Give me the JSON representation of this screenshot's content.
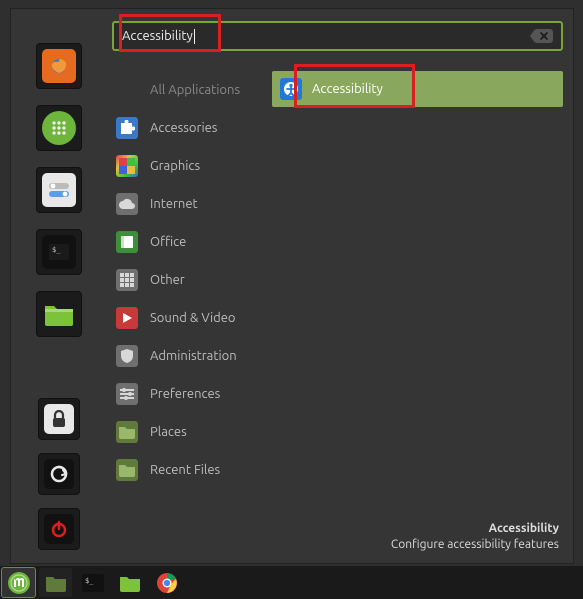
{
  "search": {
    "value": "Accessibility"
  },
  "favorites_apps": [
    {
      "name": "firefox",
      "icon": "firefox-icon",
      "bg": "#e66a1f"
    },
    {
      "name": "apps",
      "icon": "grid-icon",
      "bg": "#6db53b"
    },
    {
      "name": "settings",
      "icon": "toggles-icon",
      "bg": "#e8e8e8"
    },
    {
      "name": "terminal",
      "icon": "terminal-icon",
      "bg": "#111111"
    },
    {
      "name": "files",
      "icon": "folder-icon",
      "bg": "#7cc33a"
    }
  ],
  "favorites_sys": [
    {
      "name": "lock",
      "icon": "lock-icon",
      "bg": "#e8e8e8"
    },
    {
      "name": "logout",
      "icon": "logout-icon",
      "bg": "#111111"
    },
    {
      "name": "shutdown",
      "icon": "power-icon",
      "bg": "#d82020"
    }
  ],
  "categories": [
    {
      "key": "all",
      "label": "All Applications",
      "icon": "",
      "bg": ""
    },
    {
      "key": "accessories",
      "label": "Accessories",
      "icon": "puzzle-icon",
      "bg": "#3a78c8"
    },
    {
      "key": "graphics",
      "label": "Graphics",
      "icon": "palette-icon",
      "bg": "linear"
    },
    {
      "key": "internet",
      "label": "Internet",
      "icon": "cloud-icon",
      "bg": "#6f6f6f"
    },
    {
      "key": "office",
      "label": "Office",
      "icon": "book-icon",
      "bg": "#3f8f3a"
    },
    {
      "key": "other",
      "label": "Other",
      "icon": "dots-icon",
      "bg": "#6f6f6f"
    },
    {
      "key": "sound",
      "label": "Sound & Video",
      "icon": "play-icon",
      "bg": "#c83a3a"
    },
    {
      "key": "admin",
      "label": "Administration",
      "icon": "shield-icon",
      "bg": "#6f6f6f"
    },
    {
      "key": "prefs",
      "label": "Preferences",
      "icon": "sliders-icon",
      "bg": "#6f6f6f"
    },
    {
      "key": "places",
      "label": "Places",
      "icon": "folder-icon",
      "bg": "#5f7a3a"
    },
    {
      "key": "recent",
      "label": "Recent Files",
      "icon": "folder-icon",
      "bg": "#5f7a3a"
    }
  ],
  "results": [
    {
      "label": "Accessibility",
      "icon": "accessibility-icon"
    }
  ],
  "footer": {
    "title": "Accessibility",
    "desc": "Configure accessibility features"
  },
  "taskbar": [
    {
      "name": "menu",
      "icon": "mint-icon",
      "active": true
    },
    {
      "name": "files",
      "icon": "folder-icon",
      "active": false
    },
    {
      "name": "terminal",
      "icon": "terminal-icon",
      "active": false
    },
    {
      "name": "files2",
      "icon": "folder-icon",
      "active": false
    },
    {
      "name": "chrome",
      "icon": "chrome-icon",
      "active": false
    }
  ]
}
